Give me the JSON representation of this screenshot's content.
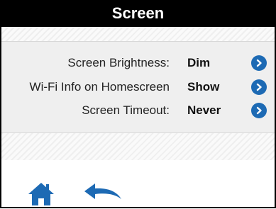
{
  "header": {
    "title": "Screen"
  },
  "settings": [
    {
      "label": "Screen Brightness:",
      "value": "Dim",
      "icon": "chevron-right-icon"
    },
    {
      "label": "Wi-Fi Info on Homescreen",
      "value": "Show",
      "icon": "chevron-right-icon"
    },
    {
      "label": "Screen Timeout:",
      "value": "Never",
      "icon": "chevron-right-icon"
    }
  ],
  "footer": {
    "home_icon": "home-icon",
    "back_icon": "back-arrow-icon"
  },
  "colors": {
    "accent": "#1d6ab4",
    "header_bg": "#000000",
    "panel_bg": "#efefef"
  }
}
